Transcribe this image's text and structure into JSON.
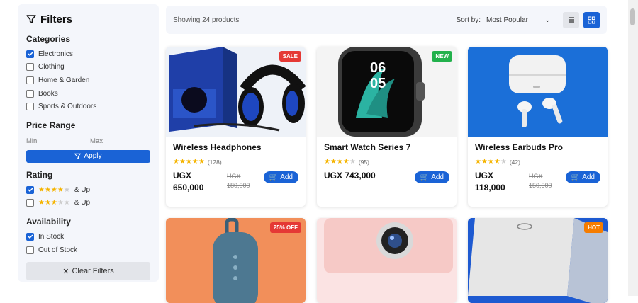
{
  "sidebar": {
    "title": "Filters",
    "categories_title": "Categories",
    "categories": [
      {
        "label": "Electronics",
        "checked": true
      },
      {
        "label": "Clothing",
        "checked": false
      },
      {
        "label": "Home & Garden",
        "checked": false
      },
      {
        "label": "Books",
        "checked": false
      },
      {
        "label": "Sports & Outdoors",
        "checked": false
      }
    ],
    "price_title": "Price Range",
    "min_placeholder": "Min",
    "max_placeholder": "Max",
    "apply_label": "Apply",
    "rating_title": "Rating",
    "ratings": [
      {
        "stars": 4,
        "label": "& Up",
        "checked": true
      },
      {
        "stars": 3,
        "label": "& Up",
        "checked": false
      }
    ],
    "availability_title": "Availability",
    "availability": [
      {
        "label": "In Stock",
        "checked": true
      },
      {
        "label": "Out of Stock",
        "checked": false
      }
    ],
    "clear_label": "Clear Filters"
  },
  "topbar": {
    "showing": "Showing 24 products",
    "sort_label": "Sort by:",
    "sort_value": "Most Popular"
  },
  "products": [
    {
      "name": "Wireless Headphones",
      "rating": 5,
      "reviews": "(128)",
      "price": "UGX 650,000",
      "old_price": "UGX 180,000",
      "badge": "SALE",
      "badge_color": "#e53935",
      "add_label": "Add"
    },
    {
      "name": "Smart Watch Series 7",
      "rating": 4,
      "reviews": "(95)",
      "price": "UGX 743,000",
      "old_price": "",
      "badge": "NEW",
      "badge_color": "#22b14c",
      "add_label": "Add"
    },
    {
      "name": "Wireless Earbuds Pro",
      "rating": 4,
      "reviews": "(42)",
      "price": "UGX 118,000",
      "old_price": "UGX 150,500",
      "badge": "",
      "badge_color": "",
      "add_label": "Add"
    },
    {
      "name": "",
      "badge": "25% OFF",
      "badge_color": "#e53935"
    },
    {
      "name": "",
      "badge": "",
      "badge_color": ""
    },
    {
      "name": "",
      "badge": "HOT",
      "badge_color": "#f57c00"
    }
  ],
  "colors": {
    "accent": "#1a63d6",
    "star": "#f5b400"
  }
}
